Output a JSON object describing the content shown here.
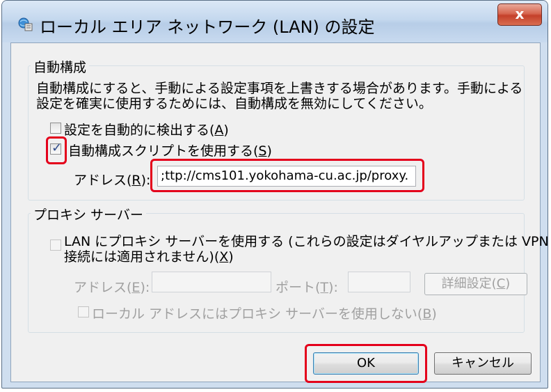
{
  "window": {
    "title": "ローカル エリア ネットワーク (LAN) の設定",
    "close_label": "x"
  },
  "auto_config": {
    "legend": "自動構成",
    "description_line1": "自動構成にすると、手動による設定事項を上書きする場合があります。手動による",
    "description_line2": "設定を確実に使用するためには、自動構成を無効にしてください。",
    "auto_detect_label": "設定を自動的に検出する(",
    "auto_detect_key": "A",
    "auto_detect_checked": false,
    "use_script_label": "自動構成スクリプトを使用する(",
    "use_script_key": "S",
    "use_script_checked": true,
    "address_label": "アドレス(",
    "address_key": "R",
    "address_value": ";ttp://cms101.yokohama-cu.ac.jp/proxy."
  },
  "proxy": {
    "legend": "プロキシ サーバー",
    "use_proxy_line1": "LAN にプロキシ サーバーを使用する (これらの設定はダイヤルアップまたは VPN",
    "use_proxy_line2": "接続には適用されません)(",
    "use_proxy_key": "X",
    "use_proxy_checked": false,
    "address_label": "アドレス(",
    "address_key": "E",
    "address_value": "",
    "port_label": "ポート(",
    "port_key": "T",
    "port_value": "",
    "advanced_label": "詳細設定(",
    "advanced_key": "C",
    "bypass_label": "ローカル アドレスにはプロキシ サーバーを使用しない(",
    "bypass_key": "B",
    "bypass_checked": false
  },
  "buttons": {
    "ok": "OK",
    "cancel": "キャンセル"
  },
  "colors": {
    "highlight": "#e4001b",
    "window_frame": "#cfdeef",
    "client_bg": "#f0f0f0"
  }
}
